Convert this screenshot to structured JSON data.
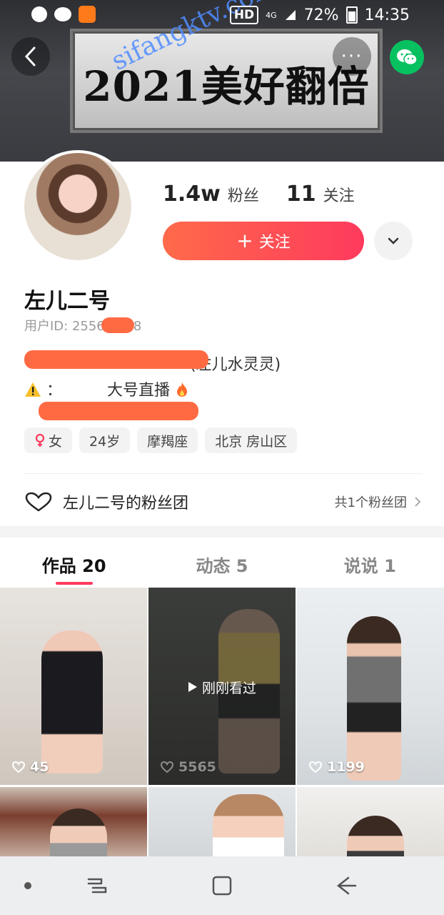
{
  "status_bar": {
    "hd": "HD",
    "network": "4G",
    "battery": "72%",
    "time": "14:35",
    "app_icons": [
      "q-app-icon",
      "wechat-icon",
      "kuaishou-icon"
    ]
  },
  "banner": {
    "text": "2021美好翻倍",
    "watermark": "sifangktv.com"
  },
  "header": {
    "more_label": "···"
  },
  "profile": {
    "followers_count": "1.4w",
    "followers_label": "粉丝",
    "following_count": "11",
    "following_label": "关注",
    "follow_button_label": "关注",
    "follow_button_icon": "+",
    "name": "左儿二号",
    "user_id": "用户ID: 2556 5478",
    "bio_line1_suffix": "(左儿水灵灵)",
    "bio_line2_prefix": "：",
    "bio_line2_text": "大号直播",
    "tags": [
      {
        "label": "女",
        "icon": "female-icon"
      },
      {
        "label": "24岁"
      },
      {
        "label": "摩羯座"
      },
      {
        "label": "北京 房山区"
      }
    ],
    "fanclub_label": "左儿二号的粉丝团",
    "fanclub_count": "共1个粉丝团"
  },
  "tabs": [
    {
      "label": "作品 20",
      "active": true
    },
    {
      "label": "动态 5",
      "active": false
    },
    {
      "label": "说说 1",
      "active": false
    }
  ],
  "videos": [
    {
      "likes": "45",
      "recent": ""
    },
    {
      "likes": "5565",
      "recent": "刚刚看过"
    },
    {
      "likes": "1199",
      "recent": ""
    },
    {
      "likes": "",
      "recent": ""
    },
    {
      "likes": "",
      "recent": ""
    },
    {
      "likes": "",
      "recent": ""
    }
  ],
  "colors": {
    "accent": "#fe3a5d",
    "follow_gradient_start": "#ff6a4a",
    "wechat_green": "#07c160"
  }
}
